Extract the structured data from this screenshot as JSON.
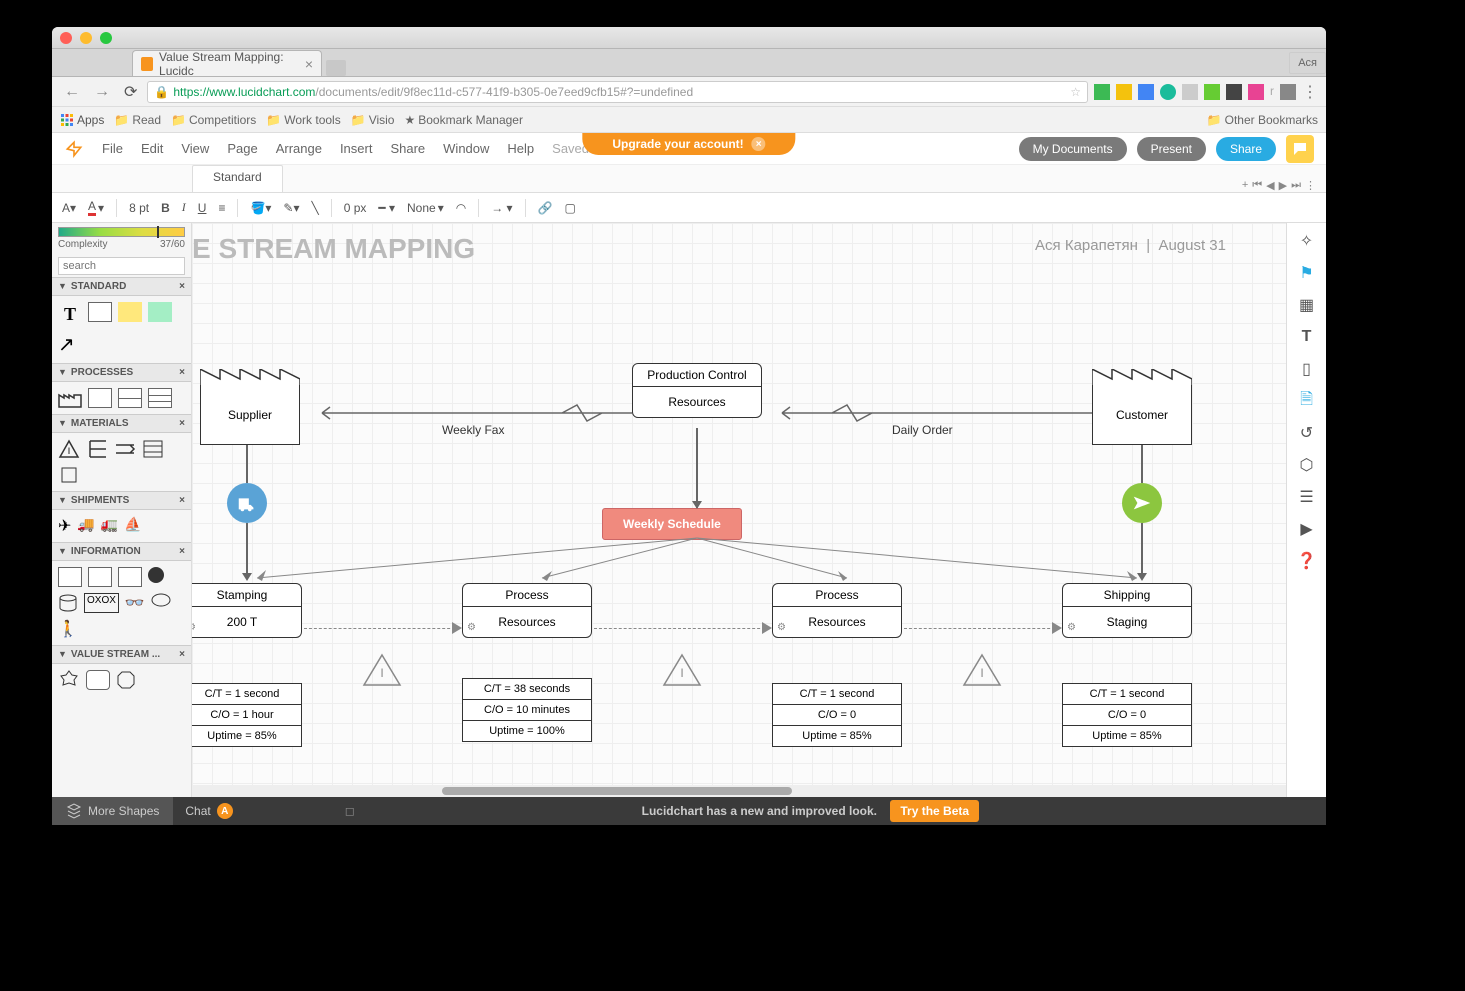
{
  "browser": {
    "tab_title": "Value Stream Mapping: Lucidc",
    "url_https": "https",
    "url_domain": "://www.lucidchart.com",
    "url_path": "/documents/edit/9f8ec11d-c577-41f9-b305-0e7eed9cfb15#?=undefined",
    "user_badge": "Ася",
    "bookmarks": {
      "apps": "Apps",
      "read": "Read",
      "competitors": "Competitiors",
      "worktools": "Work tools",
      "visio": "Visio",
      "bookmark_manager": "Bookmark Manager",
      "other": "Other Bookmarks"
    }
  },
  "app": {
    "upgrade": "Upgrade your account!",
    "menu": {
      "file": "File",
      "edit": "Edit",
      "view": "View",
      "page": "Page",
      "arrange": "Arrange",
      "insert": "Insert",
      "share": "Share",
      "window": "Window",
      "help": "Help",
      "saved": "Saved"
    },
    "buttons": {
      "mydocs": "My Documents",
      "present": "Present",
      "share": "Share"
    },
    "page_tab": "Standard",
    "toolbar": {
      "fontsize": "8 pt",
      "border": "0 px",
      "linestyle": "None"
    }
  },
  "sidebar": {
    "complexity_label": "Complexity",
    "complexity_value": "37/60",
    "search_placeholder": "search",
    "shelves": {
      "standard": "STANDARD",
      "processes": "PROCESSES",
      "materials": "MATERIALS",
      "shipments": "SHIPMENTS",
      "information": "INFORMATION",
      "vsm": "VALUE STREAM ..."
    },
    "more_shapes": "More Shapes"
  },
  "canvas": {
    "title": "E STREAM MAPPING",
    "author": "Ася Карапетян",
    "date": "August 31",
    "supplier": "Supplier",
    "customer": "Customer",
    "prod_control_hdr": "Production Control",
    "prod_control_sub": "Resources",
    "weekly_fax": "Weekly Fax",
    "daily_order": "Daily Order",
    "schedule": "Weekly Schedule",
    "processes": {
      "p1": {
        "hdr": "Stamping",
        "sub": "200 T"
      },
      "p2": {
        "hdr": "Process",
        "sub": "Resources"
      },
      "p3": {
        "hdr": "Process",
        "sub": "Resources"
      },
      "p4": {
        "hdr": "Shipping",
        "sub": "Staging"
      }
    },
    "data": {
      "d1": {
        "r1": "C/T = 1 second",
        "r2": "C/O = 1 hour",
        "r3": "Uptime = 85%"
      },
      "d2": {
        "r1": "C/T = 38 seconds",
        "r2": "C/O = 10 minutes",
        "r3": "Uptime = 100%"
      },
      "d3": {
        "r1": "C/T = 1 second",
        "r2": "C/O = 0",
        "r3": "Uptime = 85%"
      },
      "d4": {
        "r1": "C/T = 1 second",
        "r2": "C/O = 0",
        "r3": "Uptime = 85%"
      }
    }
  },
  "footer": {
    "chat": "Chat",
    "chat_badge": "A",
    "news": "Lucidchart has a new and improved look.",
    "beta": "Try the Beta"
  }
}
